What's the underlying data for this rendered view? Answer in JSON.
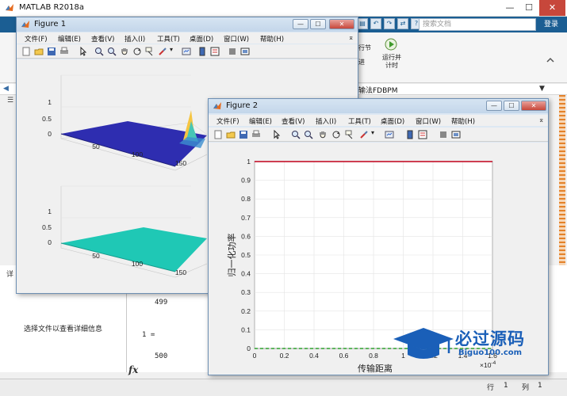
{
  "matlab": {
    "title": "MATLAB R2018a",
    "search_placeholder": "搜索文档",
    "login": "登录",
    "ribbon": {
      "run_section": "行节",
      "advance": "进",
      "run_and_time": "运行并\n计时"
    },
    "file_tab": "输法FDBPM",
    "details_label": "详",
    "select_file_info": "选择文件以查看详细信息",
    "command_lines": [
      "499",
      "1 =",
      "500"
    ],
    "prompt_symbol": "fx",
    "status": {
      "row_label": "行",
      "row_value": "1",
      "col_label": "列",
      "col_value": "1"
    }
  },
  "figure1": {
    "title": "Figure 1",
    "menu": [
      "文件(F)",
      "编辑(E)",
      "查看(V)",
      "插入(I)",
      "工具(T)",
      "桌面(D)",
      "窗口(W)",
      "帮助(H)"
    ],
    "top_plot": {
      "z_ticks": [
        "1",
        "0.5",
        "0"
      ],
      "x_ticks": [
        "50",
        "100",
        "150"
      ]
    },
    "bottom_plot": {
      "z_ticks": [
        "1",
        "0.5",
        "0"
      ],
      "x_ticks": [
        "50",
        "100",
        "150"
      ]
    },
    "colors": {
      "surface_top": "#2e2db0",
      "surface_bottom": "#1fc8b5",
      "peak": "#f5c542"
    }
  },
  "figure2": {
    "title": "Figure 2",
    "menu": [
      "文件(F)",
      "编辑(E)",
      "查看(V)",
      "插入(I)",
      "工具(T)",
      "桌面(D)",
      "窗口(W)",
      "帮助(H)"
    ],
    "chart_data": {
      "type": "line",
      "xlabel": "传输距离",
      "ylabel": "归一化功率",
      "x_exponent_label": "×10",
      "x_exponent_power": "-4",
      "xlim": [
        0,
        1.6
      ],
      "ylim": [
        0,
        1
      ],
      "x_ticks": [
        "0",
        "0.2",
        "0.4",
        "0.6",
        "0.8",
        "1",
        "1.2",
        "1.4",
        "1.6"
      ],
      "y_ticks": [
        "0",
        "0.1",
        "0.2",
        "0.3",
        "0.4",
        "0.5",
        "0.6",
        "0.7",
        "0.8",
        "0.9",
        "1"
      ],
      "grid": true,
      "series": [
        {
          "color": "#c0001a",
          "x": [
            0,
            1.6
          ],
          "y": [
            1,
            1
          ]
        },
        {
          "color": "#2ca02c",
          "x": [
            0,
            1.6
          ],
          "y": [
            0,
            0
          ],
          "dashed": true
        }
      ]
    }
  },
  "watermark": {
    "main": "必过源码",
    "sub": "Biguo100.com"
  }
}
